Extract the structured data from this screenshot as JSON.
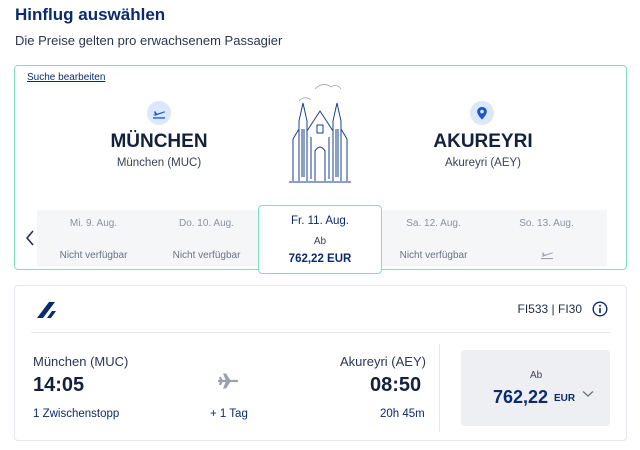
{
  "header": {
    "title": "Hinflug auswählen",
    "subtitle": "Die Preise gelten pro erwachsenem Passagier"
  },
  "search": {
    "edit_label": "Suche bearbeiten",
    "origin": {
      "code": "MÜNCHEN",
      "name": "München (MUC)",
      "icon": "departure-icon"
    },
    "destination": {
      "code": "AKUREYRI",
      "name": "Akureyri (AEY)",
      "icon": "location-pin-icon"
    }
  },
  "dates": [
    {
      "label": "Mi. 9. Aug.",
      "status": "Nicht verfügbar"
    },
    {
      "label": "Do. 10. Aug.",
      "status": "Nicht verfügbar"
    },
    {
      "label": "Fr. 11. Aug.",
      "from": "Ab",
      "price": "762,22 EUR",
      "selected": true
    },
    {
      "label": "Sa. 12. Aug.",
      "status": "Nicht verfügbar"
    },
    {
      "label": "So. 13. Aug.",
      "icon": "flight-icon"
    }
  ],
  "flight": {
    "flight_numbers": "FI533 | FI30",
    "departure_city": "München (MUC)",
    "departure_time": "14:05",
    "stops": "1 Zwischenstopp",
    "day_offset": "+ 1 Tag",
    "arrival_city": "Akureyri (AEY)",
    "arrival_time": "08:50",
    "duration": "20h 45m",
    "price_from": "Ab",
    "price": "762,22",
    "currency": "EUR"
  },
  "colors": {
    "primary": "#0b2a6f",
    "accent_border": "#7ee0c0",
    "icon_bg": "#dbe7fb"
  }
}
